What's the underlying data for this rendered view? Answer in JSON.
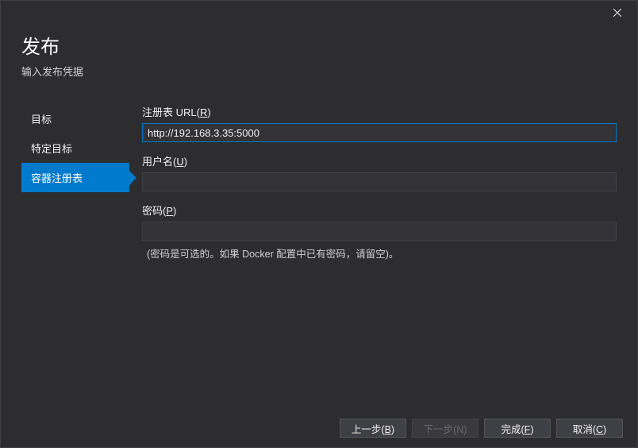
{
  "header": {
    "title": "发布",
    "subtitle": "输入发布凭据"
  },
  "sidebar": {
    "items": [
      {
        "label": "目标"
      },
      {
        "label": "特定目标"
      },
      {
        "label": "容器注册表"
      }
    ]
  },
  "form": {
    "registry": {
      "label_prefix": "注册表 URL(",
      "label_key": "R",
      "label_suffix": ")",
      "value": "http://192.168.3.35:5000"
    },
    "username": {
      "label_prefix": "用户名(",
      "label_key": "U",
      "label_suffix": ")",
      "value": ""
    },
    "password": {
      "label_prefix": "密码(",
      "label_key": "P",
      "label_suffix": ")",
      "value": "",
      "help": "(密码是可选的。如果 Docker 配置中已有密码，请留空)。"
    }
  },
  "buttons": {
    "back_prefix": "上一步(",
    "back_key": "B",
    "back_suffix": ")",
    "next_prefix": "下一步(",
    "next_key": "N",
    "next_suffix": ")",
    "finish_prefix": "完成(",
    "finish_key": "F",
    "finish_suffix": ")",
    "cancel_prefix": "取消(",
    "cancel_key": "C",
    "cancel_suffix": ")"
  }
}
